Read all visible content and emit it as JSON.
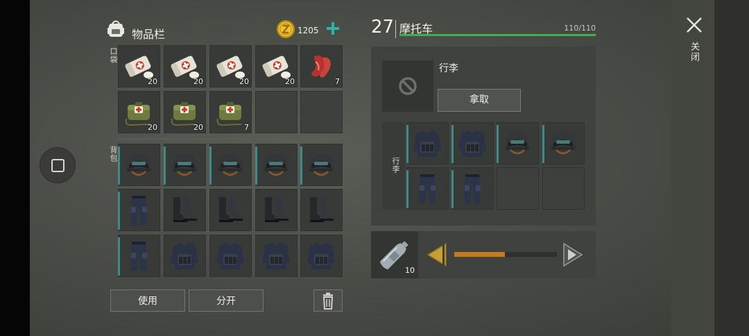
{
  "inventory": {
    "title": "物品栏",
    "coins": "1205",
    "pocket_label": "口袋",
    "backpack_label": "背包",
    "pocket_slots": [
      {
        "item": "bandage",
        "count": "20"
      },
      {
        "item": "bandage",
        "count": "20"
      },
      {
        "item": "bandage",
        "count": "20"
      },
      {
        "item": "bandage",
        "count": "20"
      },
      {
        "item": "raw-meat",
        "count": "7"
      },
      {
        "item": "medkit",
        "count": "20"
      },
      {
        "item": "medkit",
        "count": "20"
      },
      {
        "item": "medkit",
        "count": "7"
      },
      {
        "item": "",
        "count": ""
      },
      {
        "item": "",
        "count": ""
      }
    ],
    "backpack_slots": [
      {
        "item": "helmet"
      },
      {
        "item": "helmet"
      },
      {
        "item": "helmet"
      },
      {
        "item": "helmet"
      },
      {
        "item": "helmet"
      },
      {
        "item": "pants"
      },
      {
        "item": "boots"
      },
      {
        "item": "boots"
      },
      {
        "item": "boots"
      },
      {
        "item": "boots"
      },
      {
        "item": "pants"
      },
      {
        "item": "vest"
      },
      {
        "item": "vest"
      },
      {
        "item": "vest"
      },
      {
        "item": "vest"
      }
    ],
    "use_button": "使用",
    "split_button": "分开"
  },
  "vehicle": {
    "level": "27",
    "name": "摩托车",
    "durability_text": "110/110",
    "durability_fraction": 1.0,
    "trunk_label": "行李",
    "take_button": "拿取",
    "trunk_side_label": "行李",
    "trunk_slots": [
      {
        "item": "vest"
      },
      {
        "item": "vest"
      },
      {
        "item": "helmet"
      },
      {
        "item": "helmet"
      },
      {
        "item": "pants"
      },
      {
        "item": "pants"
      },
      {
        "item": ""
      },
      {
        "item": ""
      }
    ],
    "fuel_item_count": "10",
    "fuel_fraction": 0.49
  },
  "close_label": "关闭",
  "colors": {
    "teal": "#3f8a86",
    "durability": "#44b04c",
    "fuel": "#c7791f",
    "arrow": "#c8a032",
    "plus": "#2fb3a5"
  }
}
